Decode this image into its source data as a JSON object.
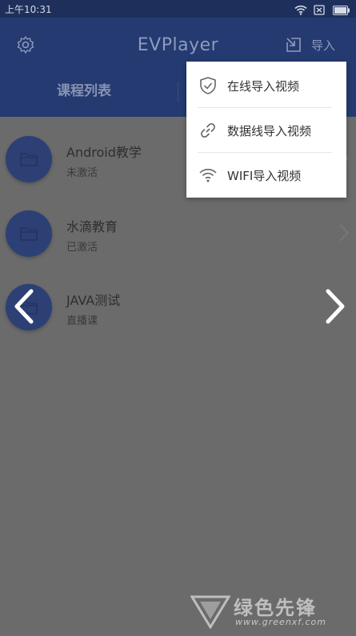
{
  "status_bar": {
    "time": "上午10:31"
  },
  "header": {
    "title": "EVPlayer",
    "import_label": "导入"
  },
  "tabs": [
    {
      "label": "课程列表"
    }
  ],
  "courses": [
    {
      "title": "Android教学",
      "status": "未激活"
    },
    {
      "title": "水滴教育",
      "status": "已激活"
    },
    {
      "title": "JAVA测试",
      "status": "直播课"
    }
  ],
  "import_menu": {
    "items": [
      {
        "label": "在线导入视频",
        "icon": "shield-check-icon"
      },
      {
        "label": "数据线导入视频",
        "icon": "link-icon"
      },
      {
        "label": "WIFI导入视频",
        "icon": "wifi-icon"
      }
    ]
  },
  "watermark": {
    "text": "绿色先锋",
    "url": "www.greenxf.com"
  },
  "colors": {
    "header": "#243a70",
    "status_bar": "#1e2f5c",
    "overlay_background": "#6b6b6b",
    "menu_background": "#ffffff",
    "folder_avatar": "#2c4076"
  }
}
